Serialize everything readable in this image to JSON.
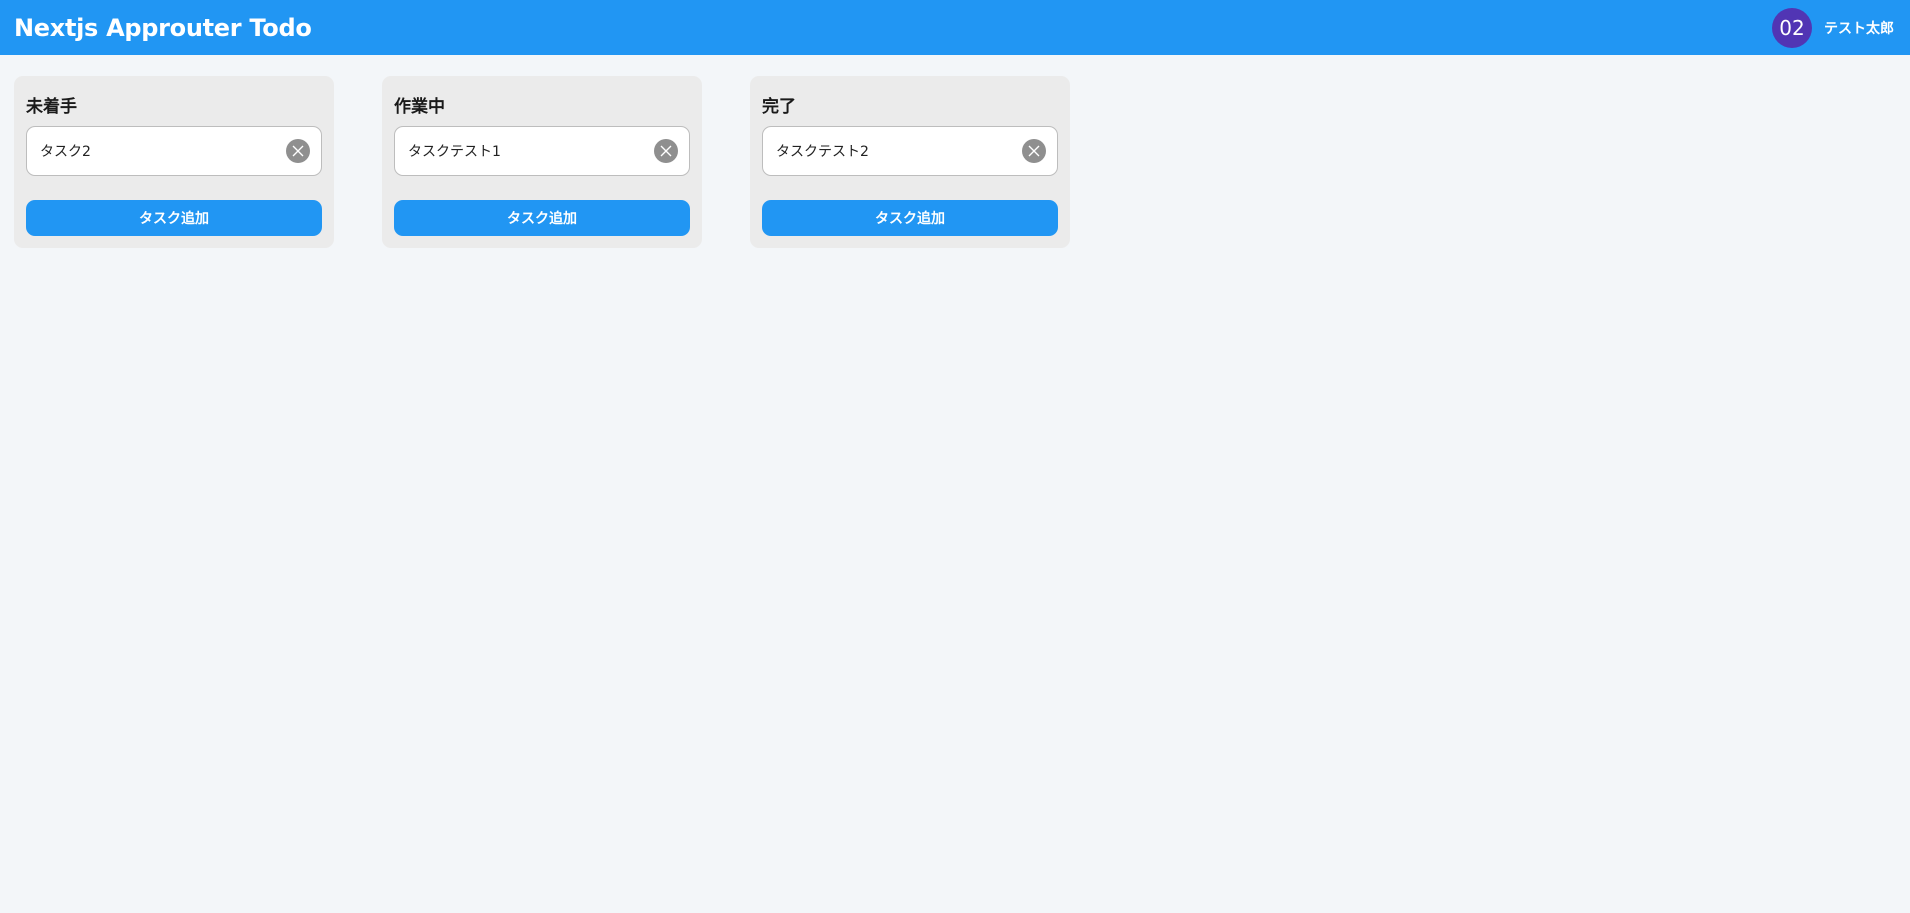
{
  "header": {
    "title": "Nextjs Approuter Todo",
    "avatar_text": "02",
    "user_name": "テスト太郎"
  },
  "columns": [
    {
      "title": "未着手",
      "tasks": [
        {
          "text": "タスク2"
        }
      ],
      "add_label": "タスク追加"
    },
    {
      "title": "作業中",
      "tasks": [
        {
          "text": "タスクテスト1"
        }
      ],
      "add_label": "タスク追加"
    },
    {
      "title": "完了",
      "tasks": [
        {
          "text": "タスクテスト2"
        }
      ],
      "add_label": "タスク追加"
    }
  ],
  "icons": {
    "delete": "close-circle-icon"
  },
  "colors": {
    "primary": "#2196f3",
    "avatar": "#5135b4",
    "column_bg": "#ebebeb",
    "page_bg": "#f3f6f9",
    "delete_icon_bg": "#8f8f8f"
  }
}
